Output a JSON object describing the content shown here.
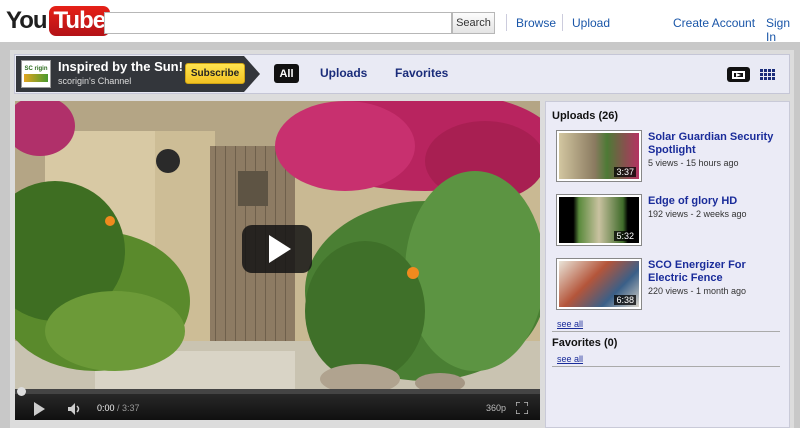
{
  "header": {
    "logo_you": "You",
    "logo_tube": "Tube",
    "search_placeholder": "",
    "search_button": "Search",
    "browse": "Browse",
    "upload": "Upload",
    "create_account": "Create Account",
    "sign_in": "Sign In"
  },
  "channel": {
    "thumb_text": "SC rigin",
    "title": "Inspired by the Sun!",
    "subtitle": "scorigin's Channel",
    "subscribe": "Subscribe",
    "tabs": [
      "All",
      "Uploads",
      "Favorites"
    ]
  },
  "player": {
    "current_time": "0:00",
    "duration": "/ 3:37",
    "quality": "360p",
    "progress_fraction": 0
  },
  "sidebar": {
    "uploads_header": "Uploads (26)",
    "videos": [
      {
        "title": "Solar Guardian Security Spotlight",
        "meta": "5 views - 15 hours ago",
        "duration": "3:37"
      },
      {
        "title": "Edge of glory HD",
        "meta": "192 views - 2 weeks ago",
        "duration": "5:32"
      },
      {
        "title": "SCO Energizer For Electric Fence",
        "meta": "220 views - 1 month ago",
        "duration": "6:38"
      }
    ],
    "see_all_uploads": "see all",
    "favorites_header": "Favorites (0)",
    "see_all_favorites": "see all"
  },
  "colors": {
    "accent_red": "#e62117",
    "link_blue": "#1a56a8",
    "subscribe_yellow": "#f2c222"
  }
}
